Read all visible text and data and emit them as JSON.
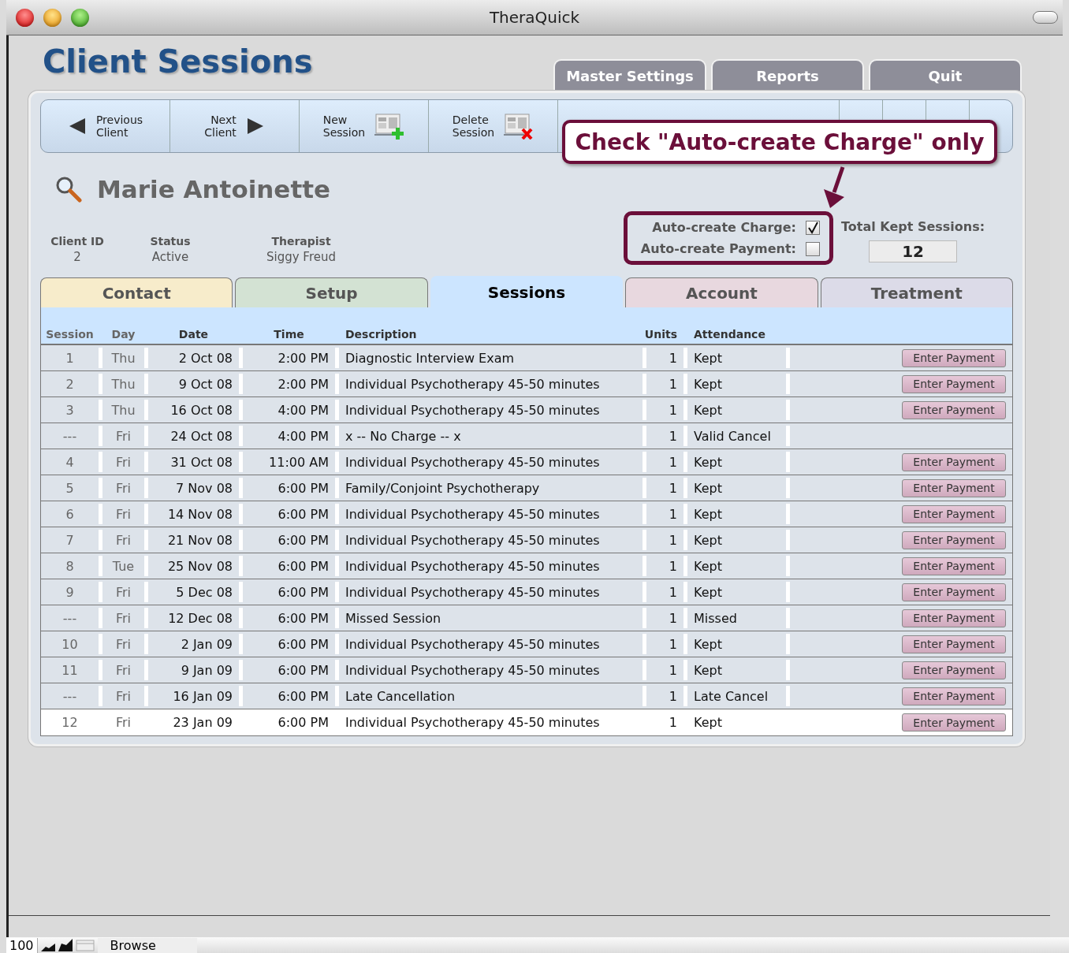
{
  "window": {
    "title": "TheraQuick"
  },
  "header": {
    "title": "Client Sessions"
  },
  "top_tabs": [
    "Master Settings",
    "Reports",
    "Quit"
  ],
  "toolbar": [
    {
      "kind": "prev",
      "label": "Previous\nClient"
    },
    {
      "kind": "next",
      "label": "Next\nClient"
    },
    {
      "kind": "new",
      "label": "New\nSession"
    },
    {
      "kind": "delete",
      "label": "Delete\nSession"
    }
  ],
  "callout": {
    "text": "Check \"Auto-create Charge\" only"
  },
  "client": {
    "name": "Marie Antoinette",
    "fields": [
      {
        "label": "Client ID",
        "value": "2"
      },
      {
        "label": "Status",
        "value": "Active"
      },
      {
        "label": "Therapist",
        "value": "Siggy Freud"
      }
    ]
  },
  "options": [
    {
      "label": "Auto-create Charge:",
      "checked": true
    },
    {
      "label": "Auto-create Payment:",
      "checked": false
    }
  ],
  "total": {
    "label": "Total Kept Sessions:",
    "value": "12"
  },
  "tabs": [
    {
      "label": "Contact",
      "selected": false,
      "color": "#f7eccb"
    },
    {
      "label": "Setup",
      "selected": false,
      "color": "#d3e2d3"
    },
    {
      "label": "Sessions",
      "selected": true,
      "color": "#cce5ff"
    },
    {
      "label": "Account",
      "selected": false,
      "color": "#e8d8df"
    },
    {
      "label": "Treatment",
      "selected": false,
      "color": "#dcdbe8"
    }
  ],
  "table": {
    "columns": [
      "Session",
      "Day",
      "Date",
      "Time",
      "Description",
      "Units",
      "Attendance"
    ],
    "rows": [
      {
        "cells": [
          "1",
          "Thu",
          "2 Oct 08",
          "2:00 PM",
          "Diagnostic Interview Exam",
          "1",
          "Kept"
        ],
        "action": "Enter Payment",
        "selected": false
      },
      {
        "cells": [
          "2",
          "Thu",
          "9 Oct 08",
          "2:00 PM",
          "Individual Psychotherapy 45-50 minutes",
          "1",
          "Kept"
        ],
        "action": "Enter Payment",
        "selected": false
      },
      {
        "cells": [
          "3",
          "Thu",
          "16 Oct 08",
          "4:00 PM",
          "Individual Psychotherapy 45-50 minutes",
          "1",
          "Kept"
        ],
        "action": "Enter Payment",
        "selected": false
      },
      {
        "cells": [
          "---",
          "Fri",
          "24 Oct 08",
          "4:00 PM",
          "x -- No Charge -- x",
          "1",
          "Valid Cancel"
        ],
        "selected": false
      },
      {
        "cells": [
          "4",
          "Fri",
          "31 Oct 08",
          "11:00 AM",
          "Individual Psychotherapy 45-50 minutes",
          "1",
          "Kept"
        ],
        "action": "Enter Payment",
        "selected": false
      },
      {
        "cells": [
          "5",
          "Fri",
          "7 Nov 08",
          "6:00 PM",
          "Family/Conjoint Psychotherapy",
          "1",
          "Kept"
        ],
        "action": "Enter Payment",
        "selected": false
      },
      {
        "cells": [
          "6",
          "Fri",
          "14 Nov 08",
          "6:00 PM",
          "Individual Psychotherapy 45-50 minutes",
          "1",
          "Kept"
        ],
        "action": "Enter Payment",
        "selected": false
      },
      {
        "cells": [
          "7",
          "Fri",
          "21 Nov 08",
          "6:00 PM",
          "Individual Psychotherapy 45-50 minutes",
          "1",
          "Kept"
        ],
        "action": "Enter Payment",
        "selected": false
      },
      {
        "cells": [
          "8",
          "Tue",
          "25 Nov 08",
          "6:00 PM",
          "Individual Psychotherapy 45-50 minutes",
          "1",
          "Kept"
        ],
        "action": "Enter Payment",
        "selected": false
      },
      {
        "cells": [
          "9",
          "Fri",
          "5 Dec 08",
          "6:00 PM",
          "Individual Psychotherapy 45-50 minutes",
          "1",
          "Kept"
        ],
        "action": "Enter Payment",
        "selected": false
      },
      {
        "cells": [
          "---",
          "Fri",
          "12 Dec 08",
          "6:00 PM",
          "Missed Session",
          "1",
          "Missed"
        ],
        "action": "Enter Payment",
        "selected": false
      },
      {
        "cells": [
          "10",
          "Fri",
          "2 Jan 09",
          "6:00 PM",
          "Individual Psychotherapy 45-50 minutes",
          "1",
          "Kept"
        ],
        "action": "Enter Payment",
        "selected": false
      },
      {
        "cells": [
          "11",
          "Fri",
          "9 Jan 09",
          "6:00 PM",
          "Individual Psychotherapy 45-50 minutes",
          "1",
          "Kept"
        ],
        "action": "Enter Payment",
        "selected": false
      },
      {
        "cells": [
          "---",
          "Fri",
          "16 Jan 09",
          "6:00 PM",
          "Late Cancellation",
          "1",
          "Late Cancel"
        ],
        "action": "Enter Payment",
        "selected": false
      },
      {
        "cells": [
          "12",
          "Fri",
          "23 Jan 09",
          "6:00 PM",
          "Individual Psychotherapy 45-50 minutes",
          "1",
          "Kept"
        ],
        "action": "Enter Payment",
        "selected": true
      }
    ]
  },
  "status_bar": {
    "zoom": "100",
    "mode": "Browse"
  }
}
